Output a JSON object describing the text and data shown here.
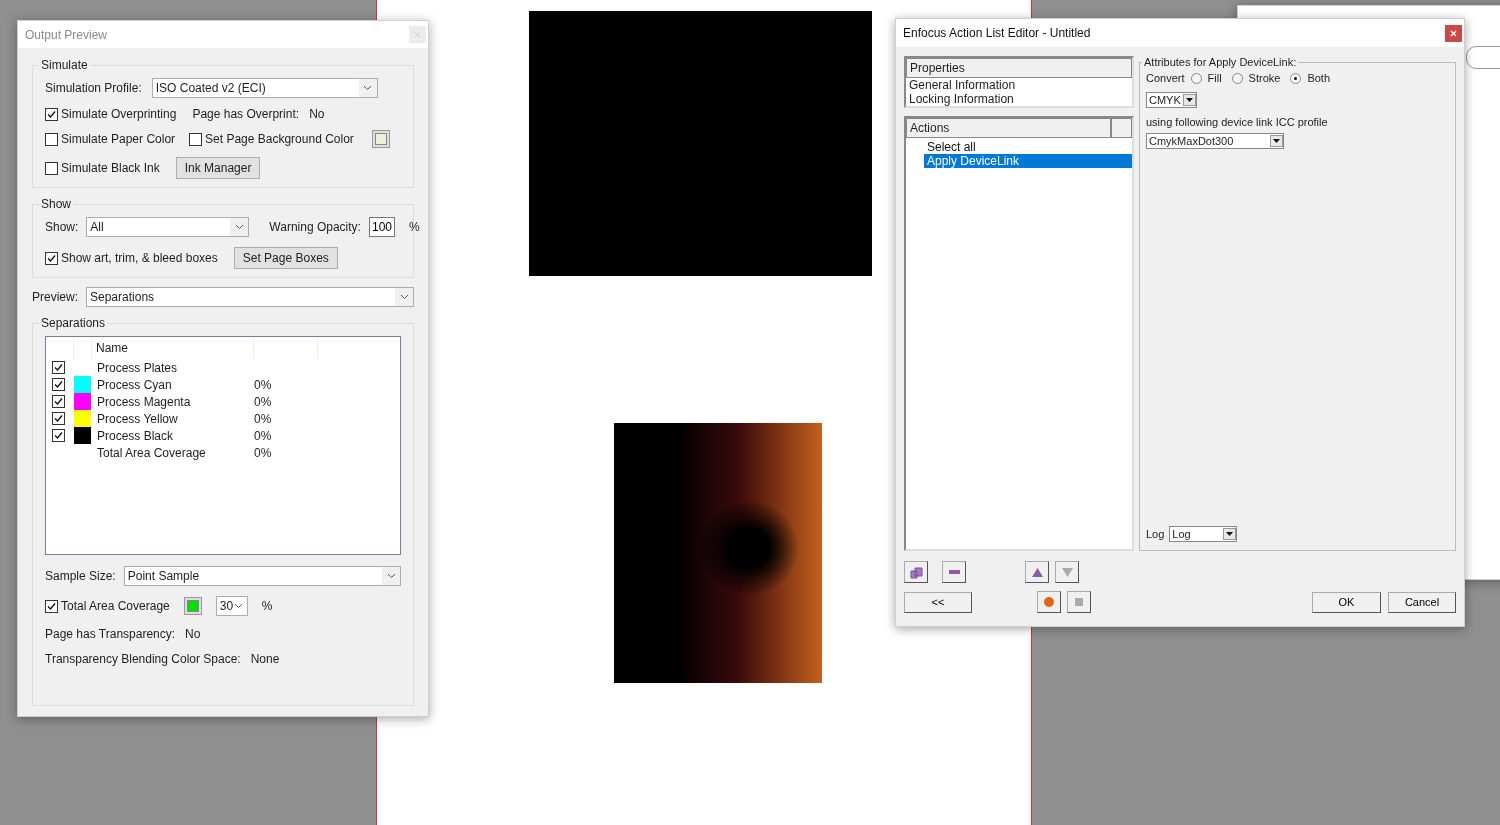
{
  "output_preview": {
    "title": "Output Preview",
    "simulate": {
      "legend": "Simulate",
      "profile_label": "Simulation Profile:",
      "profile_value": "ISO Coated v2 (ECI)",
      "overprint": {
        "label": "Simulate Overprinting",
        "checked": true
      },
      "page_overprint_label": "Page has Overprint:",
      "page_overprint_value": "No",
      "paper_color": {
        "label": "Simulate Paper Color",
        "checked": false
      },
      "page_background": {
        "label": "Set Page Background Color",
        "checked": false
      },
      "black_ink": {
        "label": "Simulate Black Ink",
        "checked": false
      },
      "ink_manager_button": "Ink Manager"
    },
    "show": {
      "legend": "Show",
      "show_label": "Show:",
      "show_value": "All",
      "opacity_label": "Warning Opacity:",
      "opacity_value": "100",
      "percent": "%",
      "boxes": {
        "label": "Show art, trim, & bleed boxes",
        "checked": true
      },
      "set_boxes_button": "Set Page Boxes"
    },
    "preview_label": "Preview:",
    "preview_value": "Separations",
    "separations": {
      "legend": "Separations",
      "name_column": "Name",
      "rows": [
        {
          "kind": "group",
          "checked": true,
          "name": "Process Plates"
        },
        {
          "kind": "ink",
          "checked": true,
          "name": "Process Cyan",
          "coverage": "0%",
          "color": "#00ffff"
        },
        {
          "kind": "ink",
          "checked": true,
          "name": "Process Magenta",
          "coverage": "0%",
          "color": "#ff00ff"
        },
        {
          "kind": "ink",
          "checked": true,
          "name": "Process Yellow",
          "coverage": "0%",
          "color": "#ffff00"
        },
        {
          "kind": "ink",
          "checked": true,
          "name": "Process Black",
          "coverage": "0%",
          "color": "#000000"
        },
        {
          "kind": "total",
          "name": "Total Area Coverage",
          "coverage": "0%"
        }
      ],
      "sample_label": "Sample Size:",
      "sample_value": "Point Sample",
      "total_coverage": {
        "label": "Total Area Coverage",
        "checked": true
      },
      "coverage_value": "30",
      "coverage_percent": "%",
      "transparency_label": "Page has Transparency:",
      "transparency_value": "No",
      "blending_label": "Transparency Blending Color Space:",
      "blending_value": "None"
    }
  },
  "action_editor": {
    "title": "Enfocus Action List Editor - Untitled",
    "properties": {
      "header": "Properties",
      "items": [
        "General Information",
        "Locking Information"
      ]
    },
    "actions": {
      "header": "Actions",
      "items": [
        {
          "label": "Select all",
          "selected": false
        },
        {
          "label": "Apply DeviceLink",
          "selected": true
        }
      ]
    },
    "attributes": {
      "legend": "Attributes for Apply DeviceLink:",
      "convert_label": "Convert",
      "options": [
        {
          "label": "Fill",
          "selected": false
        },
        {
          "label": "Stroke",
          "selected": false
        },
        {
          "label": "Both",
          "selected": true
        }
      ],
      "colorspace_value": "CMYK",
      "profile_label": "using following device link ICC profile",
      "profile_value": "CmykMaxDot300",
      "log_label": "Log",
      "log_value": "Log"
    },
    "back_button": "<<",
    "ok_button": "OK",
    "cancel_button": "Cancel"
  }
}
